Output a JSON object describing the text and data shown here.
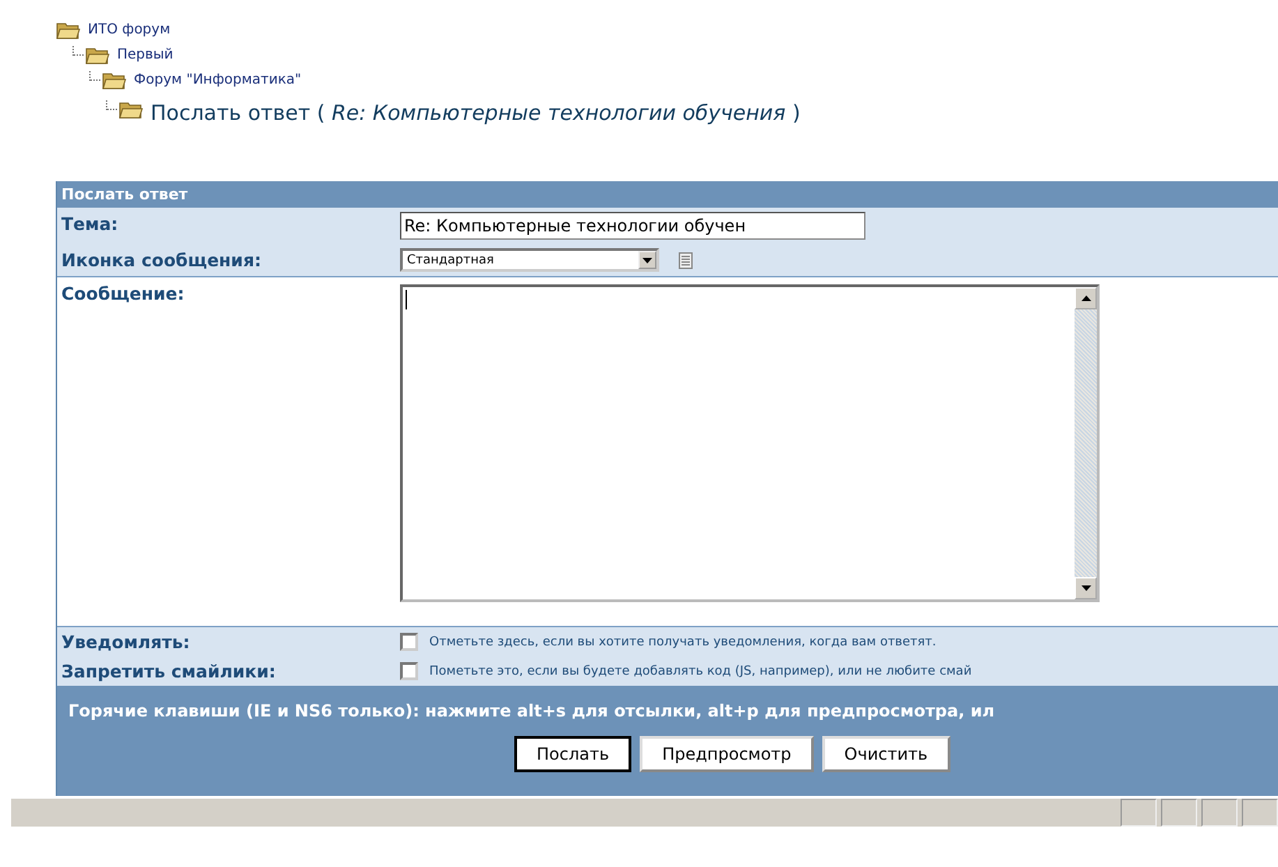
{
  "breadcrumb": [
    {
      "label": "ИТО форум",
      "children": [
        {
          "label": "Первый",
          "children": [
            {
              "label": "Форум \"Информатика\"",
              "children": [
                {
                  "label": "Послать ответ ( *Re: Компьютерные технологии обучения* )"
                }
              ]
            }
          ]
        }
      ]
    }
  ],
  "form": {
    "title": "Послать ответ",
    "subject": {
      "label": "Тема:",
      "value": "Re: Компьютерные технологии обучен"
    },
    "icon": {
      "label": "Иконка сообщения:",
      "value": "Стандартная"
    },
    "message": {
      "label": "Сообщение:"
    },
    "options": [
      {
        "label": "Уведомлять:",
        "checked": false,
        "text": "Отметьте здесь, если вы хотите получать уведомления, когда вам ответят."
      },
      {
        "label": "Запретить смайлики:",
        "checked": false,
        "text": "Пометьте это, если вы будете добавлять код (JS, например), или не любите смай"
      }
    ],
    "hotkeys": "Горячие клавиши (IE и NS6 только): нажмите alt+s для отсылки, alt+p для предпросмотра, ил",
    "buttons": [
      "Послать",
      "Предпросмотр",
      "Очистить"
    ]
  }
}
